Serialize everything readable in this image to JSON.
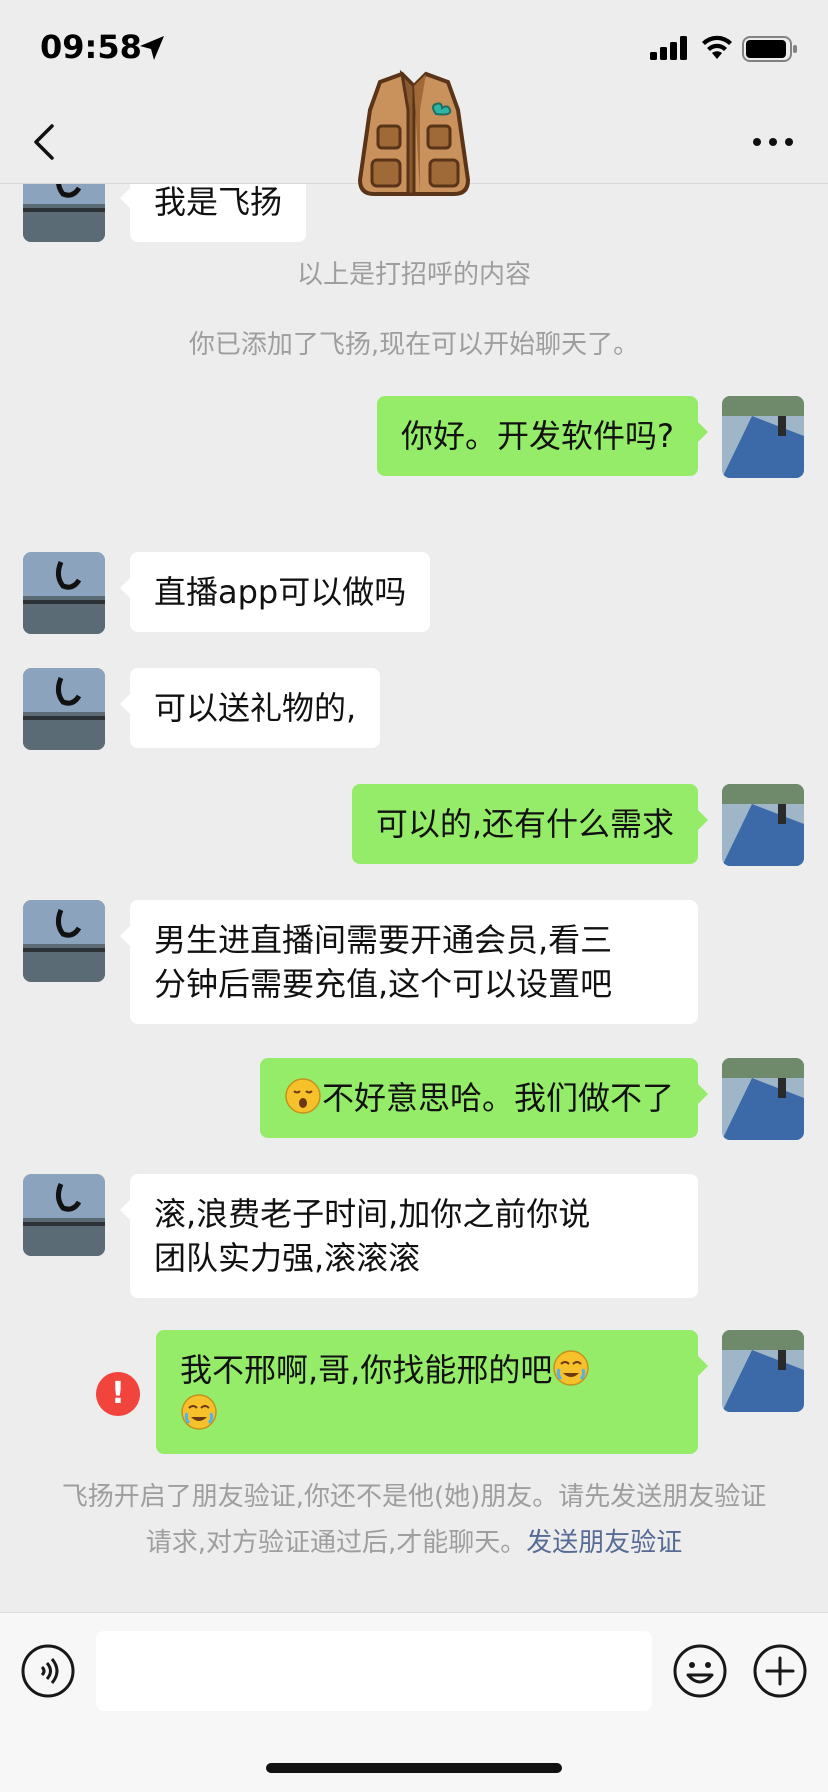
{
  "status_bar": {
    "time": "09:58"
  },
  "chat": {
    "messages": [
      {
        "side": "left",
        "text": "我是飞扬"
      },
      {
        "side": "right",
        "text": "你好。开发软件吗?"
      },
      {
        "side": "left",
        "text": "直播app可以做吗"
      },
      {
        "side": "left",
        "text": "可以送礼物的,"
      },
      {
        "side": "right",
        "text": "可以的,还有什么需求"
      },
      {
        "side": "left",
        "line1": "男生进直播间需要开通会员,看三",
        "line2": "分钟后需要充值,这个可以设置吧"
      },
      {
        "side": "right",
        "text": "不好意思哈。我们做不了",
        "emoji": "sleepy-face-emoji"
      },
      {
        "side": "left",
        "line1": "滚,浪费老子时间,加你之前你说",
        "line2": "团队实力强,滚滚滚"
      },
      {
        "side": "right",
        "line1": "我不邢啊,哥,你找能邢的吧",
        "emoji": "crying-laughing-emoji",
        "status": "failed"
      }
    ],
    "system_messages": {
      "greeting_note": "以上是打招呼的内容",
      "added_note": "你已添加了飞扬,现在可以开始聊天了。"
    },
    "notice": {
      "text": "飞扬开启了朋友验证,你还不是他(她)朋友。请先发送朋友验证请求,对方验证通过后,才能聊天。",
      "link": "发送朋友验证"
    }
  },
  "header": {
    "more_icon": "more-dots-icon",
    "back_icon": "back-chevron-icon"
  },
  "colors": {
    "bubble_self": "#95ec69",
    "bubble_other": "#ffffff",
    "background": "#ededed",
    "link": "#576b95",
    "error": "#f0443d"
  }
}
